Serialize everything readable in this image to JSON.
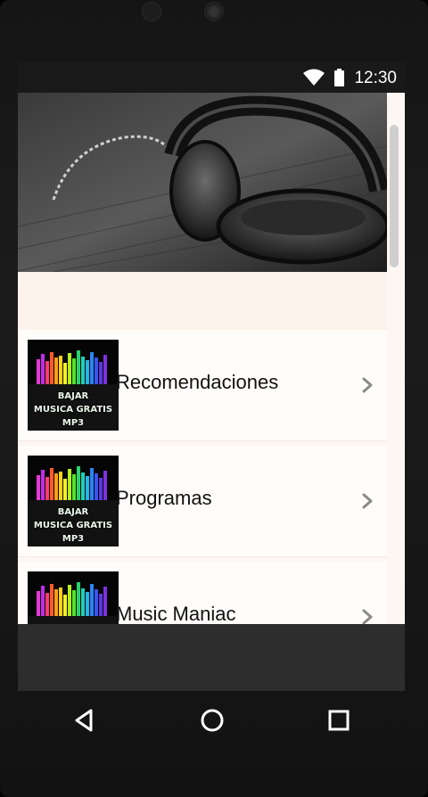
{
  "status_bar": {
    "time": "12:30",
    "icons": [
      "wifi-icon",
      "battery-icon"
    ]
  },
  "hero": {
    "image": "headphones-photo"
  },
  "list": {
    "items": [
      {
        "label": "Recomendaciones",
        "thumbnail_text": [
          "BAJAR",
          "MUSICA GRATIS",
          "MP3"
        ],
        "icon": "chevron-right-icon"
      },
      {
        "label": "Programas",
        "thumbnail_text": [
          "BAJAR",
          "MUSICA GRATIS",
          "MP3"
        ],
        "icon": "chevron-right-icon"
      },
      {
        "label": "Music Maniac",
        "thumbnail_text": [],
        "icon": "chevron-right-icon"
      }
    ]
  },
  "navigation": {
    "buttons": [
      "back-icon",
      "home-icon",
      "recents-icon"
    ]
  },
  "colors": {
    "list_background": "#fffcfa",
    "header_band": "#fdf3ec",
    "text": "#111111",
    "chevron": "#8a8a8a",
    "status_bar": "#191919"
  }
}
